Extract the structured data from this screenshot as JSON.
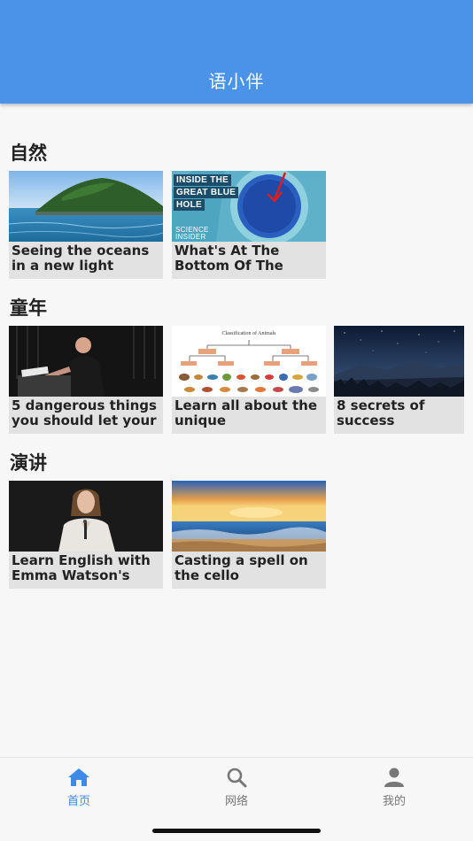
{
  "header": {
    "title": "语小伴"
  },
  "sections": [
    {
      "title": "自然",
      "cards": [
        {
          "title": "Seeing the oceans in a new light",
          "thumb": "island-ocean-image"
        },
        {
          "title": "What's At The Bottom Of The",
          "thumb": "blue-hole-image",
          "overlay": {
            "line1": "INSIDE THE",
            "line2": "GREAT BLUE",
            "line3": "HOLE",
            "brand1": "SCIENCE",
            "brand2": "INSIDER"
          }
        }
      ]
    },
    {
      "title": "童年",
      "cards": [
        {
          "title": "5 dangerous things you should let your",
          "thumb": "speaker-podium-image"
        },
        {
          "title": "Learn all about the unique",
          "thumb": "animal-classification-image",
          "overlay": {
            "caption": "Classification of Animals"
          }
        },
        {
          "title": "8 secrets of success",
          "thumb": "night-sky-mountains-image"
        }
      ]
    },
    {
      "title": "演讲",
      "cards": [
        {
          "title": "Learn English with Emma Watson's",
          "thumb": "emma-watson-speech-image"
        },
        {
          "title": "Casting a spell on the cello",
          "thumb": "sunset-beach-image"
        }
      ]
    }
  ],
  "bottom_nav": {
    "items": [
      {
        "label": "首页",
        "icon": "home-icon",
        "active": true
      },
      {
        "label": "网络",
        "icon": "search-icon",
        "active": false
      },
      {
        "label": "我的",
        "icon": "person-icon",
        "active": false
      }
    ],
    "active_color": "#3d8be6",
    "inactive_color": "#777777"
  },
  "colors": {
    "header": "#4a93e8",
    "background": "#f7f7f7",
    "card": "#e2e2e2"
  }
}
